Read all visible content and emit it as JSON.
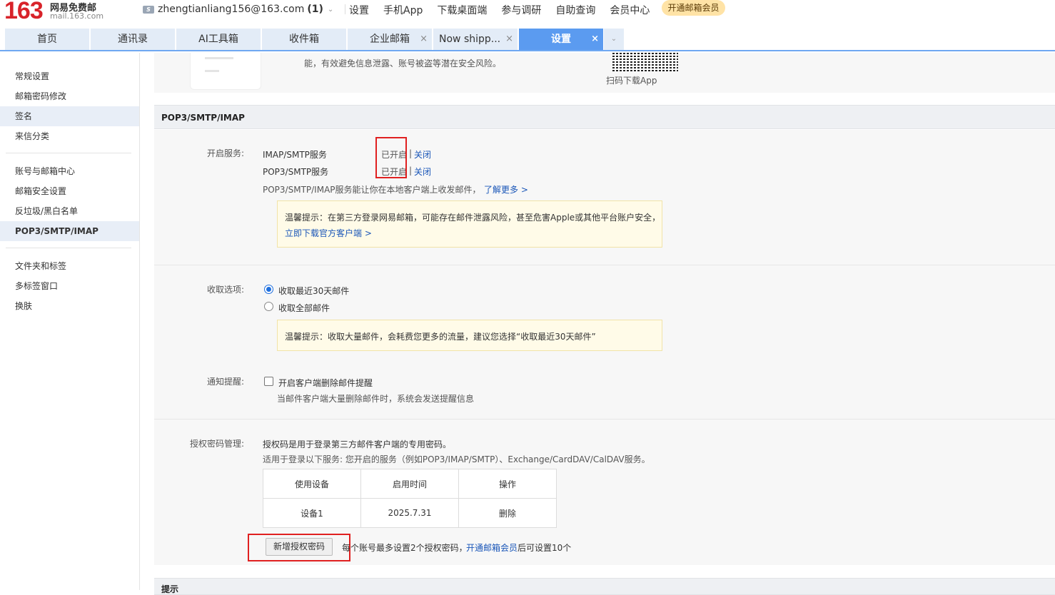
{
  "brand": {
    "number": "163",
    "name": "网易免费邮",
    "domain": "mail.163.com"
  },
  "account": {
    "icon_letter": "S",
    "email": "zhengtianliang156@163.com",
    "count": "(1)"
  },
  "top_links": [
    "设置",
    "手机App",
    "下载桌面端",
    "参与调研",
    "自助查询",
    "会员中心"
  ],
  "vip_button": "开通邮箱会员",
  "tabs": [
    {
      "label": "首页"
    },
    {
      "label": "通讯录"
    },
    {
      "label": "AI工具箱"
    },
    {
      "label": "收件箱"
    },
    {
      "label": "企业邮箱"
    },
    {
      "label": "Now shipp..."
    },
    {
      "label": "设置"
    }
  ],
  "sidebar": {
    "group1": [
      "常规设置",
      "邮箱密码修改",
      "签名",
      "来信分类"
    ],
    "group2": [
      "账号与邮箱中心",
      "邮箱安全设置",
      "反垃圾/黑白名单",
      "POP3/SMTP/IMAP"
    ],
    "group3": [
      "文件夹和标签",
      "多标签窗口",
      "换肤"
    ]
  },
  "top_panel": {
    "partial_text": "能，有效避免信息泄露、账号被盗等潜在安全风险。",
    "qr_caption": "扫码下载App"
  },
  "section": {
    "title": "POP3/SMTP/IMAP",
    "services_label": "开启服务:",
    "services": [
      {
        "name": "IMAP/SMTP服务",
        "status": "已开启",
        "action": "关闭"
      },
      {
        "name": "POP3/SMTP服务",
        "status": "已开启",
        "action": "关闭"
      }
    ],
    "separator": "|",
    "desc": "POP3/SMTP/IMAP服务能让你在本地客户端上收发邮件，",
    "learn_more": "了解更多 >",
    "tip1_text": "温馨提示：在第三方登录网易邮箱，可能存在邮件泄露风险，甚至危害Apple或其他平台账户安全，",
    "tip1_link": "立即下载官方客户端 >",
    "receive_label": "收取选项:",
    "receive_options": [
      "收取最近30天邮件",
      "收取全部邮件"
    ],
    "tip2_text": "温馨提示：收取大量邮件，会耗费您更多的流量，建议您选择“收取最近30天邮件”",
    "notify_label": "通知提醒:",
    "notify_option": "开启客户端删除邮件提醒",
    "notify_desc": "当邮件客户端大量删除邮件时，系统会发送提醒信息",
    "auth_label": "授权密码管理:",
    "auth_desc1": "授权码是用于登录第三方邮件客户端的专用密码。",
    "auth_desc2": "适用于登录以下服务: 您开启的服务（例如POP3/IMAP/SMTP）、Exchange/CardDAV/CalDAV服务。",
    "auth_table": {
      "headers": [
        "使用设备",
        "启用时间",
        "操作"
      ],
      "rows": [
        [
          "设备1",
          "2025.7.31",
          "删除"
        ]
      ]
    },
    "add_button": "新增授权密码",
    "limit_text_before": "每个账号最多设置2个授权密码，",
    "limit_link": "开通邮箱会员",
    "limit_text_after": "后可设置10个",
    "next_section_title": "提示"
  }
}
